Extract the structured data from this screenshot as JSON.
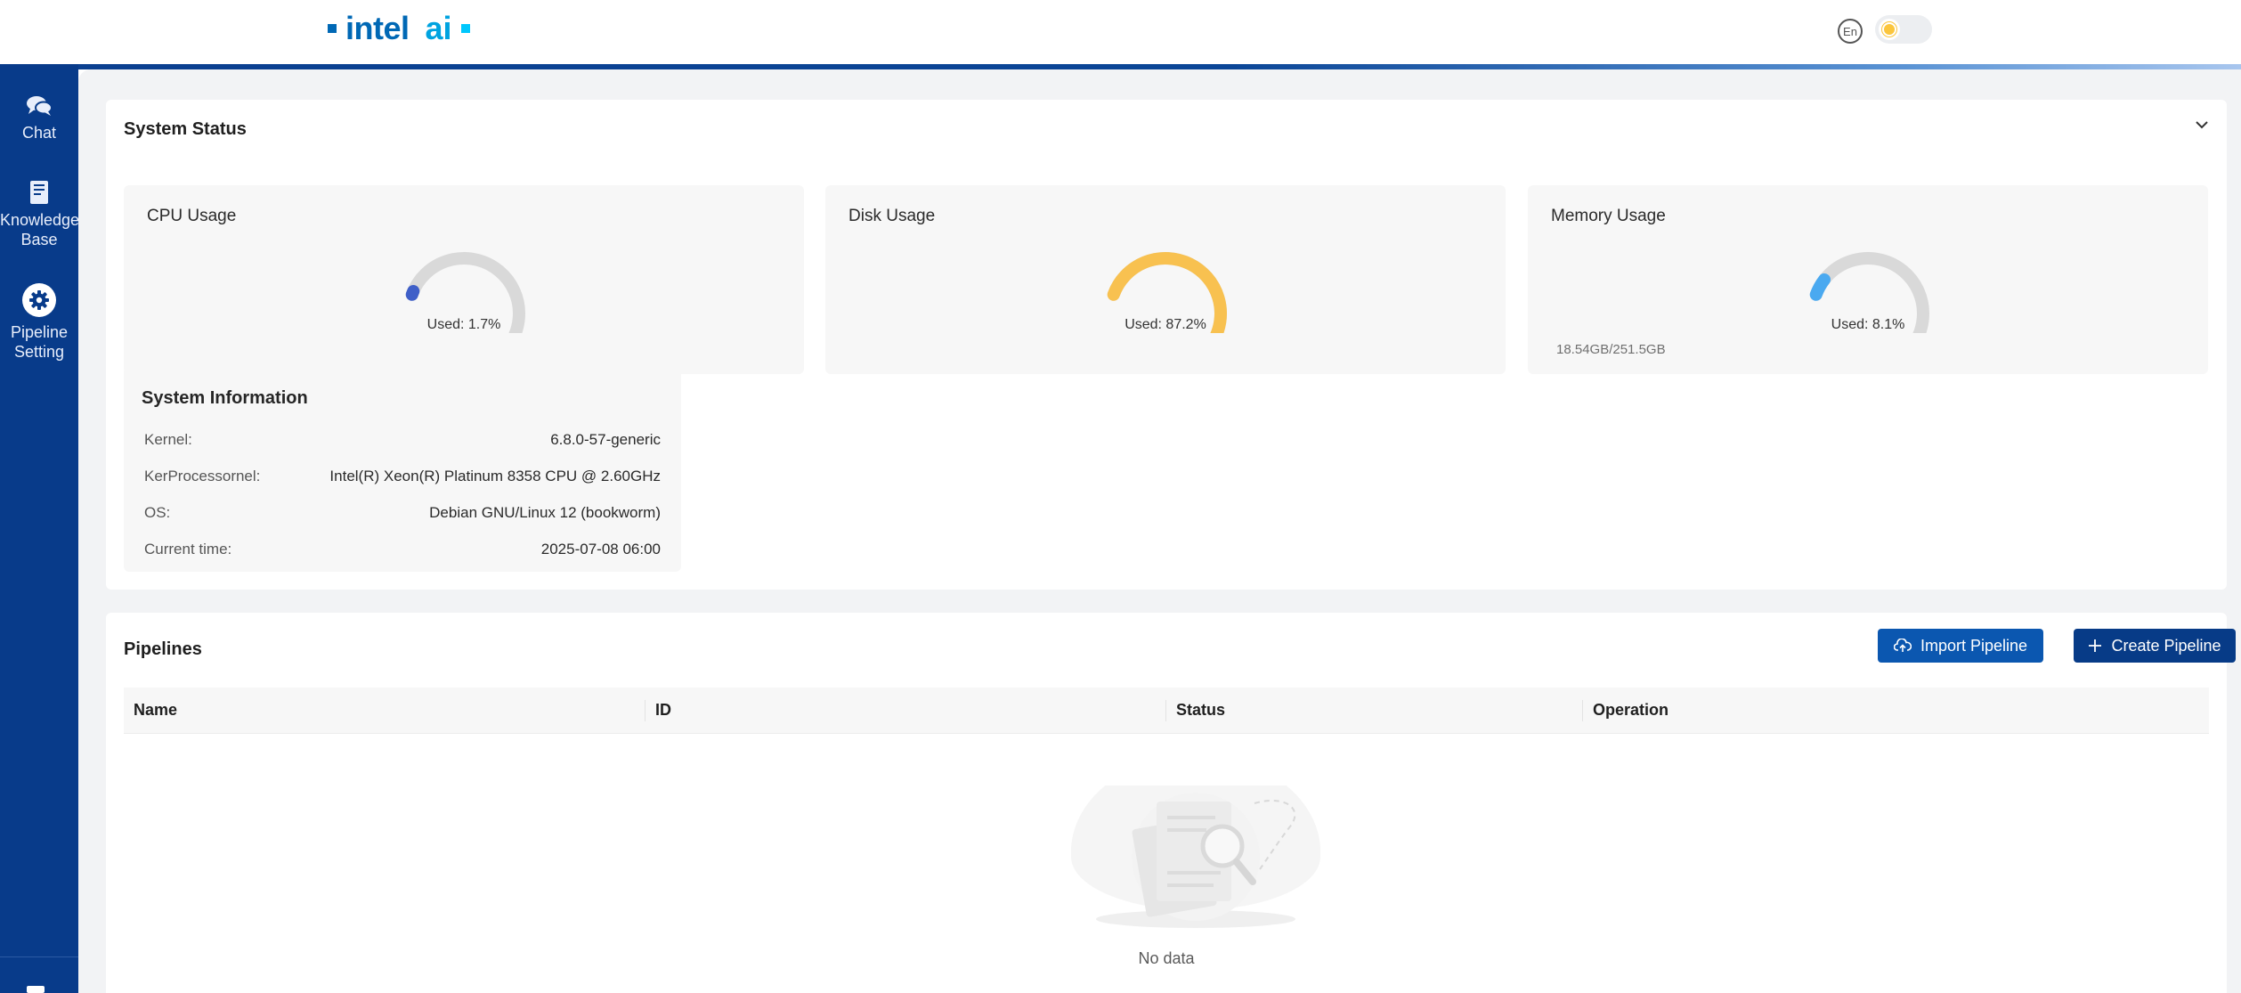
{
  "header": {
    "logo_word": "intel",
    "logo_ai": "ai",
    "language_label": "En",
    "theme_toggle": "light"
  },
  "sidebar": {
    "items": [
      {
        "label": "Chat",
        "icon": "chat-icon"
      },
      {
        "label_line1": "Knowledge",
        "label_line2": "Base",
        "icon": "document-icon"
      },
      {
        "label_line1": "Pipeline",
        "label_line2": "Setting",
        "icon": "gear-icon"
      }
    ]
  },
  "system_status": {
    "title": "System Status",
    "gauges": [
      {
        "title": "CPU Usage",
        "label": "Used: 1.7%",
        "percent": 1.7,
        "color": "#3f5fc8"
      },
      {
        "title": "Disk Usage",
        "label": "Used: 87.2%",
        "percent": 87.2,
        "color": "#f8c150"
      },
      {
        "title": "Memory Usage",
        "label": "Used: 8.1%",
        "percent": 8.1,
        "color": "#4aa9f0",
        "sub": "18.54GB/251.5GB"
      }
    ],
    "info": {
      "title": "System Information",
      "rows": [
        {
          "key": "Kernel:",
          "value": "6.8.0-57-generic"
        },
        {
          "key": "KerProcessornel:",
          "value": "Intel(R) Xeon(R) Platinum 8358 CPU @ 2.60GHz"
        },
        {
          "key": "OS:",
          "value": "Debian GNU/Linux 12 (bookworm)"
        },
        {
          "key": "Current time:",
          "value": "2025-07-08 06:00"
        }
      ]
    }
  },
  "pipelines": {
    "title": "Pipelines",
    "import_label": "Import Pipeline",
    "create_label": "Create Pipeline",
    "columns": [
      "Name",
      "ID",
      "Status",
      "Operation"
    ],
    "empty_text": "No data"
  }
}
